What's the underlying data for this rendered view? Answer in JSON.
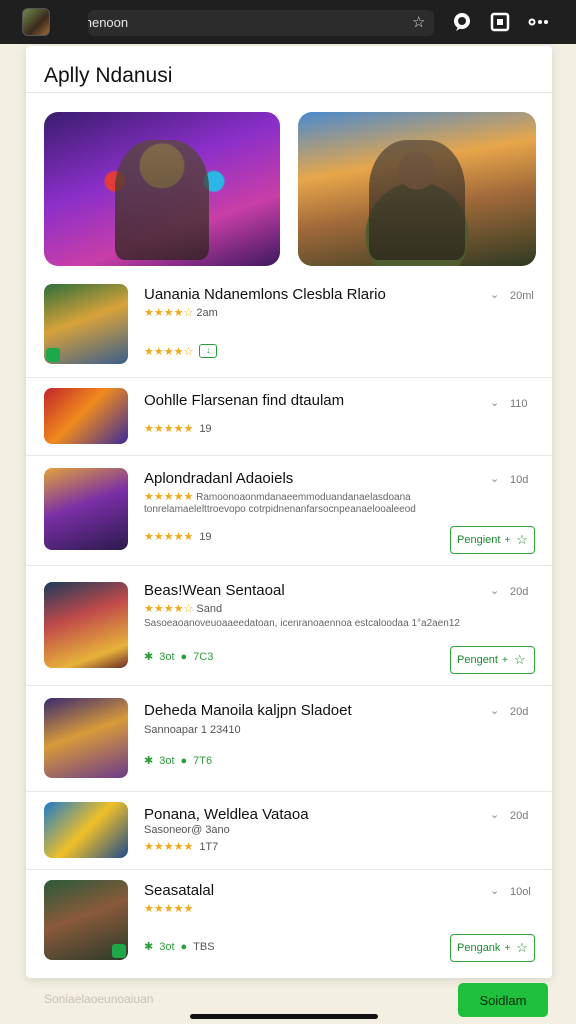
{
  "browser": {
    "url_text": "Nolanenoon",
    "icons": [
      "app-icon",
      "star-icon",
      "chat-icon",
      "tabs-icon",
      "more-icon"
    ]
  },
  "page": {
    "title": "Aplly Ndanusi"
  },
  "apps": [
    {
      "title": "Uanania Ndanemlons Clesbla Rlario",
      "rating_text": "2am",
      "meta_text": "",
      "size": "20ml",
      "has_button": false
    },
    {
      "title": "Oohlle Flarsenan find dtaulam",
      "rating_text": "",
      "meta_text": "19",
      "size": "110",
      "has_button": false
    },
    {
      "title": "Aplondradanl Adaoiels",
      "rating_text": "Ramoonoaonmdanaeemmoduandanaelasdoana",
      "desc_text": "tonrelamaelelttroevopo cotrpidnenanfarsocnpeanaelooaleeod",
      "meta_text": "19",
      "size": "10d",
      "has_button": true,
      "button_label": "Pengient"
    },
    {
      "title": "Beas!Wean Sentaoal",
      "rating_text": "Sand",
      "desc_text": "Sasoeaoanoveuoaaeedatoan, icenranoaennoa estcaloodaa 1°a2aen12",
      "meta_text": "3ot",
      "meta_box": "7C3",
      "size": "20d",
      "has_button": true,
      "button_label": "Pengent"
    },
    {
      "title": "Deheda Manoila kaljpn Sladoet",
      "rating_text": "Sannoapar 1 23410",
      "meta_text": "3ot",
      "meta_box": "7T6",
      "size": "20d",
      "has_button": false
    },
    {
      "title": "Ponana, Weldlea Vataoa",
      "rating_text": "Sasoneor@ 3ano",
      "meta_text": "1T7",
      "size": "20d",
      "has_button": false
    },
    {
      "title": "Seasatalal",
      "rating_text": "",
      "meta_text": "3ot",
      "meta_box": "TBS",
      "size": "10ol",
      "has_button": true,
      "button_label": "Pengank"
    }
  ],
  "footer": {
    "label": "Soniaelaoeunoaiuan",
    "install_label": "Soidlam"
  }
}
